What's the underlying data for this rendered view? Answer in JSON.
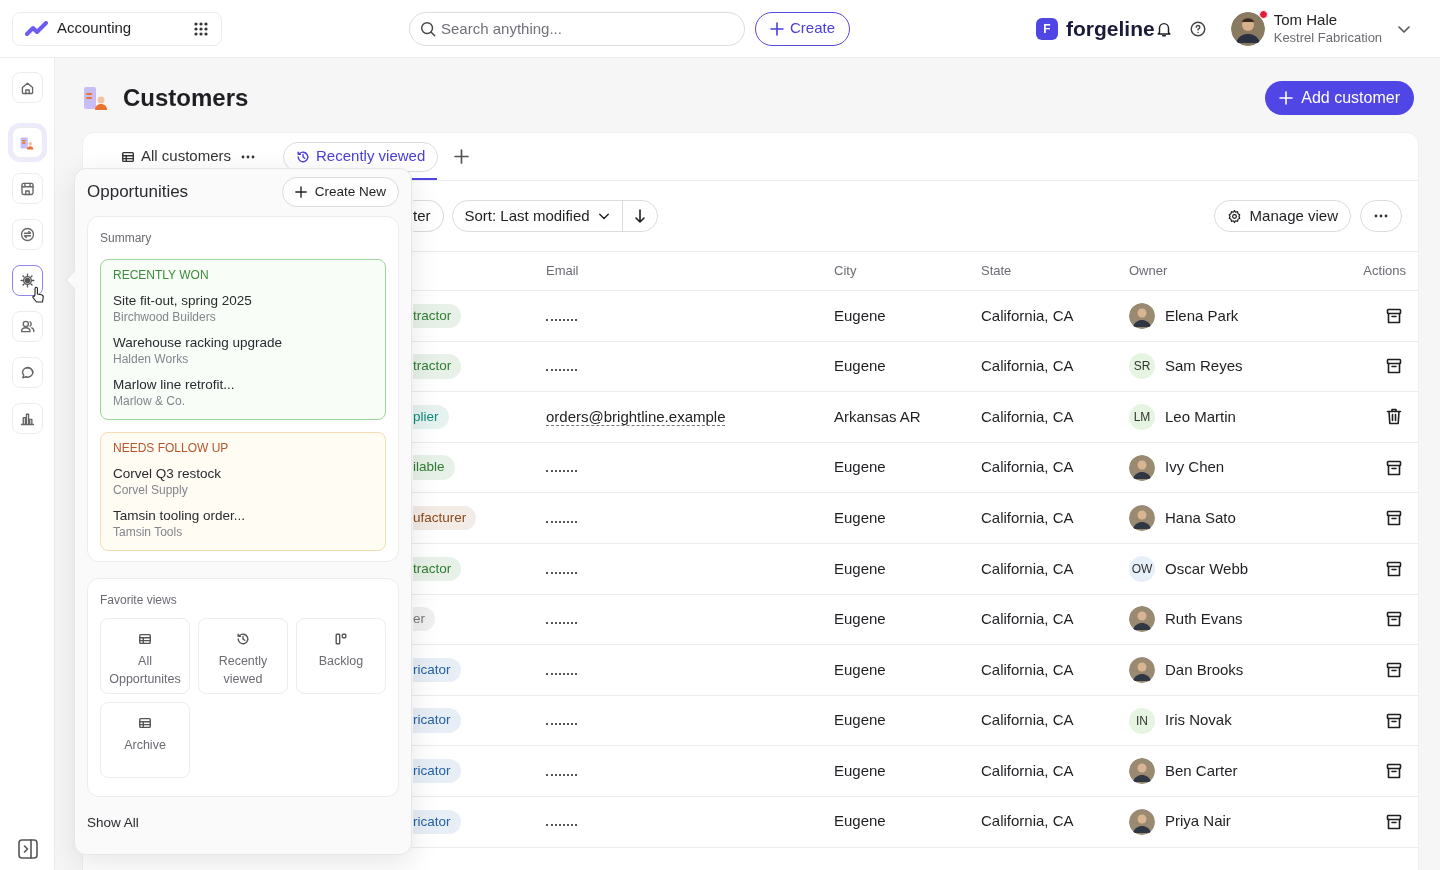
{
  "app_switcher": {
    "label": "Accounting"
  },
  "search": {
    "placeholder": "Search anything..."
  },
  "create_button": {
    "label": "Create"
  },
  "brand": {
    "mark": "F",
    "name": "forgeline"
  },
  "user": {
    "name": "Tom Hale",
    "company": "Kestrel Fabrication",
    "has_notification": true
  },
  "rail": [
    {
      "kind": "home",
      "selected": false,
      "popover_open": false
    },
    {
      "kind": "customers",
      "selected": true,
      "popover_open": false
    },
    {
      "kind": "store",
      "selected": false,
      "popover_open": false
    },
    {
      "kind": "exchange",
      "selected": false,
      "popover_open": false
    },
    {
      "kind": "sun",
      "selected": false,
      "popover_open": true
    },
    {
      "kind": "users",
      "selected": false,
      "popover_open": false
    },
    {
      "kind": "chat",
      "selected": false,
      "popover_open": false
    },
    {
      "kind": "chart",
      "selected": false,
      "popover_open": false
    }
  ],
  "page": {
    "title": "Customers",
    "primary_action": "Add customer"
  },
  "view_tabs": [
    {
      "label": "All customers",
      "selected": false,
      "has_menu": true
    },
    {
      "label": "Recently viewed",
      "selected": true,
      "has_menu": false
    }
  ],
  "toolbar": {
    "filter_label": "ter",
    "sort_label": "Sort: Last modified",
    "manage_label": "Manage view"
  },
  "table": {
    "columns": [
      "Email",
      "City",
      "State",
      "Owner",
      "Actions"
    ],
    "rows": [
      {
        "kind": "archive",
        "tag": {
          "label": "tractor",
          "color": "#2f7d32"
        },
        "city": "Eugene",
        "state": "California, CA",
        "owner": {
          "name": "Elena Park"
        }
      },
      {
        "kind": "archive",
        "tag": {
          "label": "tractor",
          "color": "#2f7d32"
        },
        "city": "Eugene",
        "state": "California, CA",
        "owner": {
          "kind": "initials",
          "initials": "SR",
          "color": "#e6f5e1",
          "name": "Sam Reyes"
        }
      },
      {
        "kind": "delete",
        "tag": {
          "label": "plier",
          "color": "#0f8a7a"
        },
        "email": "orders@brightline.example",
        "city": "Arkansas AR",
        "state": "California, CA",
        "owner": {
          "kind": "initials",
          "initials": "LM",
          "color": "#e6f5e1",
          "name": "Leo Martin"
        }
      },
      {
        "kind": "archive",
        "tag": {
          "label": "ilable",
          "color": "#2f7d32"
        },
        "city": "Eugene",
        "state": "California, CA",
        "owner": {
          "name": "Ivy Chen"
        }
      },
      {
        "kind": "archive",
        "tag": {
          "label": "ufacturer",
          "color": "#8a4a1a"
        },
        "city": "Eugene",
        "state": "California, CA",
        "owner": {
          "name": "Hana Sato"
        }
      },
      {
        "kind": "archive",
        "tag": {
          "label": "tractor",
          "color": "#2f7d32"
        },
        "city": "Eugene",
        "state": "California, CA",
        "owner": {
          "kind": "initials",
          "initials": "OW",
          "color": "#e6effa",
          "name": "Oscar Webb"
        }
      },
      {
        "kind": "archive",
        "tag": {
          "label": "er",
          "color": "#777777"
        },
        "city": "Eugene",
        "state": "California, CA",
        "owner": {
          "name": "Ruth Evans"
        }
      },
      {
        "kind": "archive",
        "tag": {
          "label": "ricator",
          "color": "#2461a8"
        },
        "city": "Eugene",
        "state": "California, CA",
        "owner": {
          "name": "Dan Brooks"
        }
      },
      {
        "kind": "archive",
        "tag": {
          "label": "ricator",
          "color": "#2461a8"
        },
        "city": "Eugene",
        "state": "California, CA",
        "owner": {
          "kind": "initials",
          "initials": "IN",
          "color": "#e6f5e1",
          "name": "Iris Novak"
        }
      },
      {
        "kind": "archive",
        "tag": {
          "label": "ricator",
          "color": "#2461a8"
        },
        "city": "Eugene",
        "state": "California, CA",
        "owner": {
          "name": "Ben Carter"
        }
      },
      {
        "kind": "archive",
        "tag": {
          "label": "ricator",
          "color": "#2461a8"
        },
        "city": "Eugene",
        "state": "California, CA",
        "owner": {
          "name": "Priya Nair"
        }
      }
    ]
  },
  "popover": {
    "title": "Opportunities",
    "create_label": "Create New",
    "summary_label": "Summary",
    "groups": [
      {
        "kind": "won",
        "heading": "RECENTLY WON",
        "items": [
          {
            "title": "Site fit-out, spring 2025",
            "company": "Birchwood Builders"
          },
          {
            "title": "Warehouse racking upgrade",
            "company": "Halden Works"
          },
          {
            "title": "Marlow line retrofit...",
            "company": "Marlow & Co."
          }
        ]
      },
      {
        "kind": "follow_up",
        "heading": "NEEDS FOLLOW UP",
        "items": [
          {
            "title": "Corvel Q3 restock",
            "company": "Corvel Supply"
          },
          {
            "title": "Tamsin tooling order...",
            "company": "Tamsin Tools"
          }
        ]
      }
    ],
    "favorites_label": "Favorite views",
    "favorites": [
      {
        "kind": "list",
        "label": "All Opportunites"
      },
      {
        "kind": "history",
        "label": "Recently viewed"
      },
      {
        "kind": "board",
        "label": "Backlog"
      },
      {
        "kind": "list",
        "label": "Archive"
      }
    ],
    "show_all": "Show All"
  }
}
